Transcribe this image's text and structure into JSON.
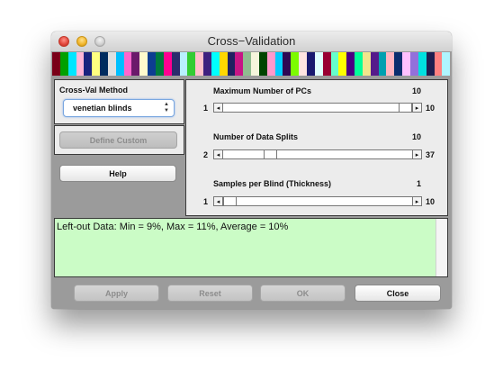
{
  "window": {
    "title": "Cross−Validation"
  },
  "stripes": [
    "#7a0018",
    "#00a000",
    "#00e6ff",
    "#ffb6d6",
    "#1a237e",
    "#ffff80",
    "#002c5f",
    "#e0e0e0",
    "#00bfff",
    "#ff66cc",
    "#6b1a6b",
    "#fffacd",
    "#0d3d91",
    "#007a3d",
    "#ff0090",
    "#2c2c6c",
    "#b8f0ff",
    "#33cc33",
    "#ffc0cb",
    "#3f1f7f",
    "#00ffff",
    "#ffd700",
    "#202060",
    "#c71585",
    "#8fbc8f",
    "#f5f5dc",
    "#004400",
    "#ff99cc",
    "#00ccff",
    "#2e0854",
    "#7cfc00",
    "#ffe4e1",
    "#191970",
    "#e0ffff",
    "#990033",
    "#66ffcc",
    "#ffff00",
    "#4b0082",
    "#00ff99",
    "#f0e68c",
    "#551a8b",
    "#00a0b0",
    "#ffb6c1",
    "#0b2d6e",
    "#ffc0ff",
    "#9370db",
    "#00e0e0",
    "#1e1e50",
    "#ff8080",
    "#aff5ff"
  ],
  "method": {
    "label": "Cross-Val Method",
    "selected": "venetian blinds"
  },
  "buttons": {
    "define_custom": "Define Custom",
    "help": "Help",
    "apply": "Apply",
    "reset": "Reset",
    "ok": "OK",
    "close": "Close"
  },
  "params": {
    "max_pcs": {
      "label": "Maximum Number of PCs",
      "value": "10",
      "min": "1",
      "max": "10",
      "fraction": 1.0
    },
    "data_splits": {
      "label": "Number of Data Splits",
      "value": "10",
      "min": "2",
      "max": "37",
      "fraction": 0.23
    },
    "blind_thickness": {
      "label": "Samples per Blind (Thickness)",
      "value": "1",
      "min": "1",
      "max": "10",
      "fraction": 0.0
    }
  },
  "output": {
    "text": "Left-out Data: Min = 9%, Max = 11%, Average = 10%"
  }
}
